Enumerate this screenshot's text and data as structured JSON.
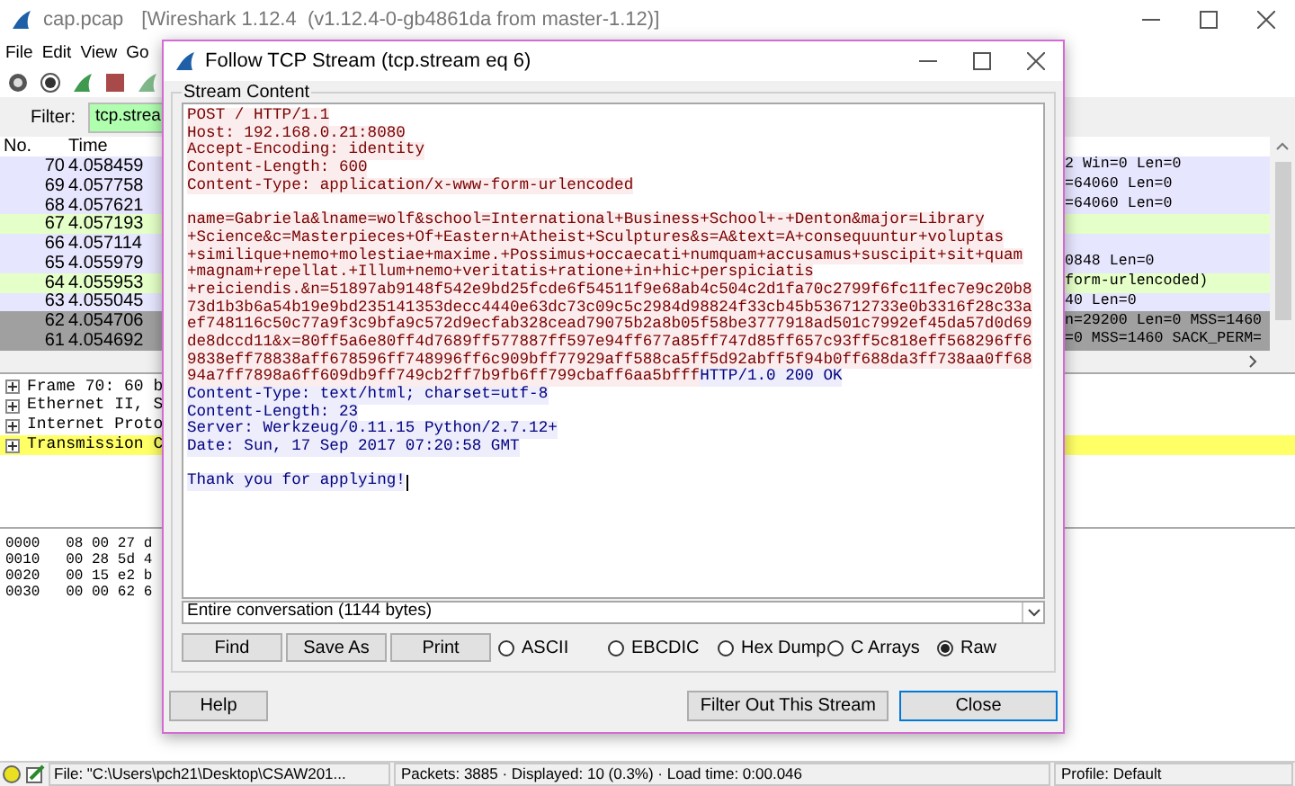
{
  "window": {
    "title": "cap.pcap",
    "subtitle": "[Wireshark 1.12.4  (v1.12.4-0-gb4861da from master-1.12)]"
  },
  "menu": [
    "File",
    "Edit",
    "View",
    "Go"
  ],
  "filter": {
    "label": "Filter:",
    "value": "tcp.strea"
  },
  "packet_list": {
    "columns": [
      "No.",
      "Time"
    ],
    "rows": [
      {
        "no": "70",
        "time": "4.058459",
        "info": "2 Win=0 Len=0",
        "color": "#e7e6ff"
      },
      {
        "no": "69",
        "time": "4.057758",
        "info": "=64060 Len=0",
        "color": "#e7e6ff"
      },
      {
        "no": "68",
        "time": "4.057621",
        "info": "=64060 Len=0",
        "color": "#e7e6ff"
      },
      {
        "no": "67",
        "time": "4.057193",
        "color": "#e4ffc7"
      },
      {
        "no": "66",
        "time": "4.057114",
        "color": "#e7e6ff"
      },
      {
        "no": "65",
        "time": "4.055979",
        "info": "0848 Len=0",
        "color": "#e7e6ff"
      },
      {
        "no": "64",
        "time": "4.055953",
        "info": "form-urlencoded)",
        "color": "#e4ffc7"
      },
      {
        "no": "63",
        "time": "4.055045",
        "info": "40 Len=0",
        "color": "#e7e6ff"
      },
      {
        "no": "62",
        "time": "4.054706",
        "info": "n=29200 Len=0 MSS=1460",
        "color": "#a0a0a0"
      },
      {
        "no": "61",
        "time": "4.054692",
        "info": "=0 MSS=1460 SACK_PERM=",
        "color": "#a0a0a0"
      }
    ]
  },
  "details": [
    {
      "text": "Frame 70: 60 b",
      "selected": false
    },
    {
      "text": "Ethernet II, S",
      "selected": false
    },
    {
      "text": "Internet Proto",
      "selected": false
    },
    {
      "text": "Transmission C",
      "selected": true
    }
  ],
  "hex": [
    "0000   08 00 27 d",
    "0010   00 28 5d 4",
    "0020   00 15 e2 b",
    "0030   00 00 62 6"
  ],
  "status_bar": {
    "file": "File: \"C:\\Users\\pch21\\Desktop\\CSAW201...",
    "packets": "Packets: 3885 · Displayed: 10 (0.3%) · Load time: 0:00.046",
    "profile": "Profile: Default"
  },
  "dialog": {
    "title": "Follow TCP Stream (tcp.stream eq 6)",
    "group": "Stream Content",
    "lines": [
      {
        "runs": [
          {
            "kind": "client",
            "text": "POST / HTTP/1.1"
          }
        ],
        "gap_after": false
      },
      {
        "runs": [
          {
            "kind": "client",
            "text": "Host: 192.168.0.21:8080"
          }
        ],
        "gap_after": false
      },
      {
        "runs": [
          {
            "kind": "client",
            "text": "Accept-Encoding: identity"
          }
        ],
        "gap_after": false
      },
      {
        "runs": [
          {
            "kind": "client",
            "text": "Content-Length: 600"
          }
        ],
        "gap_after": false
      },
      {
        "runs": [
          {
            "kind": "client",
            "text": "Content-Type: application/x-www-form-urlencoded"
          }
        ],
        "gap_after": true
      },
      {
        "runs": [
          {
            "kind": "client",
            "text": "name=Gabriela&lname=wolf&school=International+Business+School+-+Denton&major=Library"
          }
        ],
        "gap_after": false
      },
      {
        "runs": [
          {
            "kind": "client",
            "text": "+Science&c=Masterpieces+Of+Eastern+Atheist+Sculptures&s=A&text=A+consequuntur+voluptas"
          }
        ],
        "gap_after": false
      },
      {
        "runs": [
          {
            "kind": "client",
            "text": "+similique+nemo+molestiae+maxime.+Possimus+occaecati+numquam+accusamus+suscipit+sit+quam"
          }
        ],
        "gap_after": false
      },
      {
        "runs": [
          {
            "kind": "client",
            "text": "+magnam+repellat.+Illum+nemo+veritatis+ratione+in+hic+perspiciatis"
          }
        ],
        "gap_after": false
      },
      {
        "runs": [
          {
            "kind": "client",
            "text": "+reiciendis.&n=51897ab9148f542e9bd25fcde6f54511f9e68ab4c504c2d1fa70c2799f6fc11fec7e9c20b8"
          }
        ],
        "gap_after": false
      },
      {
        "runs": [
          {
            "kind": "client",
            "text": "73d1b3b6a54b19e9bd235141353decc4440e63dc73c09c5c2984d98824f33cb45b536712733e0b3316f28c33a"
          }
        ],
        "gap_after": false
      },
      {
        "runs": [
          {
            "kind": "client",
            "text": "ef748116c50c77a9f3c9bfa9c572d9ecfab328cead79075b2a8b05f58be3777918ad501c7992ef45da57d0d69"
          }
        ],
        "gap_after": false
      },
      {
        "runs": [
          {
            "kind": "client",
            "text": "de8dccd11&x=80ff5a6e80ff4d7689ff577887ff597e94ff677a85ff747d85ff657c93ff5c818eff568296ff6"
          }
        ],
        "gap_after": false
      },
      {
        "runs": [
          {
            "kind": "client",
            "text": "9838eff78838aff678596ff748996ff6c909bff77929aff588ca5ff5d92abff5f94b0ff688da3ff738aa0ff68"
          }
        ],
        "gap_after": false
      },
      {
        "runs": [
          {
            "kind": "client",
            "text": "94a7ff7898a6ff609db9ff749cb2ff7b9fb6ff799cbaff6aa5bfff"
          },
          {
            "kind": "server",
            "text": "HTTP/1.0 200 OK"
          }
        ],
        "gap_after": false
      },
      {
        "runs": [
          {
            "kind": "server",
            "text": "Content-Type: text/html; charset=utf-8"
          }
        ],
        "gap_after": false
      },
      {
        "runs": [
          {
            "kind": "server",
            "text": "Content-Length: 23"
          }
        ],
        "gap_after": false
      },
      {
        "runs": [
          {
            "kind": "server",
            "text": "Server: Werkzeug/0.11.15 Python/2.7.12+"
          }
        ],
        "gap_after": false
      },
      {
        "runs": [
          {
            "kind": "server",
            "text": "Date: Sun, 17 Sep 2017 07:20:58 GMT"
          }
        ],
        "gap_after": true
      },
      {
        "runs": [
          {
            "kind": "server",
            "text": "Thank you for applying!"
          }
        ],
        "gap_after": false
      }
    ],
    "conversation": "Entire conversation (1144 bytes)",
    "tools": [
      "Find",
      "Save As",
      "Print"
    ],
    "formats": [
      {
        "label": "ASCII",
        "selected": false
      },
      {
        "label": "EBCDIC",
        "selected": false
      },
      {
        "label": "Hex Dump",
        "selected": false
      },
      {
        "label": "C Arrays",
        "selected": false
      },
      {
        "label": "Raw",
        "selected": true
      }
    ],
    "footer": [
      {
        "label": "Help",
        "default": false
      },
      {
        "label": "Filter Out This Stream",
        "default": false
      },
      {
        "label": "Close",
        "default": true
      }
    ]
  }
}
